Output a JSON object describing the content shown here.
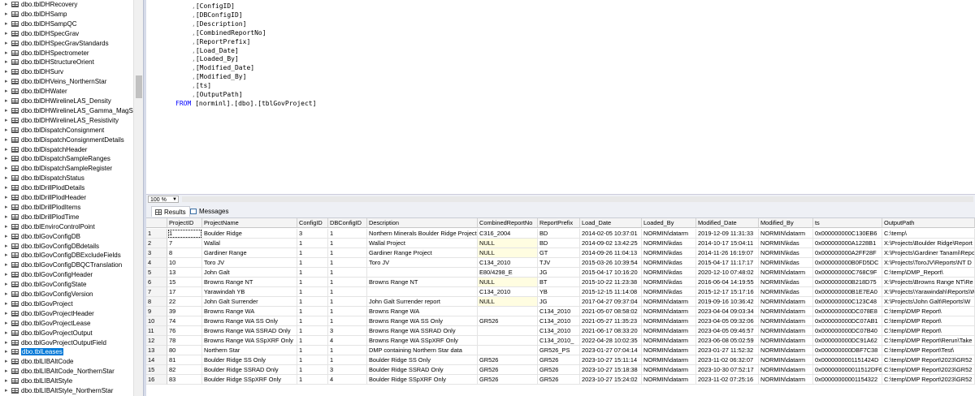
{
  "explorer": {
    "items": [
      {
        "label": "dbo.tblDHRecovery",
        "selected": false
      },
      {
        "label": "dbo.tblDHSamp",
        "selected": false
      },
      {
        "label": "dbo.tblDHSampQC",
        "selected": false
      },
      {
        "label": "dbo.tblDHSpecGrav",
        "selected": false
      },
      {
        "label": "dbo.tblDHSpecGravStandards",
        "selected": false
      },
      {
        "label": "dbo.tblDHSpectrometer",
        "selected": false
      },
      {
        "label": "dbo.tblDHStructureOrient",
        "selected": false
      },
      {
        "label": "dbo.tblDHSurv",
        "selected": false
      },
      {
        "label": "dbo.tblDHVeins_NorthernStar",
        "selected": false
      },
      {
        "label": "dbo.tblDHWater",
        "selected": false
      },
      {
        "label": "dbo.tblDHWirelineLAS_Density",
        "selected": false
      },
      {
        "label": "dbo.tblDHWirelineLAS_Gamma_MagS",
        "selected": false
      },
      {
        "label": "dbo.tblDHWirelineLAS_Resistivity",
        "selected": false
      },
      {
        "label": "dbo.tblDispatchConsignment",
        "selected": false
      },
      {
        "label": "dbo.tblDispatchConsignmentDetails",
        "selected": false
      },
      {
        "label": "dbo.tblDispatchHeader",
        "selected": false
      },
      {
        "label": "dbo.tblDispatchSampleRanges",
        "selected": false
      },
      {
        "label": "dbo.tblDispatchSampleRegister",
        "selected": false
      },
      {
        "label": "dbo.tblDispatchStatus",
        "selected": false
      },
      {
        "label": "dbo.tblDrillPlodDetails",
        "selected": false
      },
      {
        "label": "dbo.tblDrillPlodHeader",
        "selected": false
      },
      {
        "label": "dbo.tblDrillPlodItems",
        "selected": false
      },
      {
        "label": "dbo.tblDrillPlodTime",
        "selected": false
      },
      {
        "label": "dbo.tblEnviroControlPoint",
        "selected": false
      },
      {
        "label": "dbo.tblGovConfigDB",
        "selected": false
      },
      {
        "label": "dbo.tblGovConfigDBdetails",
        "selected": false
      },
      {
        "label": "dbo.tblGovConfigDBExcludeFields",
        "selected": false
      },
      {
        "label": "dbo.tblGovConfigDBQCTranslation",
        "selected": false
      },
      {
        "label": "dbo.tblGovConfigHeader",
        "selected": false
      },
      {
        "label": "dbo.tblGovConfigState",
        "selected": false
      },
      {
        "label": "dbo.tblGovConfigVersion",
        "selected": false
      },
      {
        "label": "dbo.tblGovProject",
        "selected": false
      },
      {
        "label": "dbo.tblGovProjectHeader",
        "selected": false
      },
      {
        "label": "dbo.tblGovProjectLease",
        "selected": false
      },
      {
        "label": "dbo.tblGovProjectOutput",
        "selected": false
      },
      {
        "label": "dbo.tblGovProjectOutputField",
        "selected": false
      },
      {
        "label": "dbo.tblLeases",
        "selected": true
      },
      {
        "label": "dbo.tblLIBAltCode",
        "selected": false
      },
      {
        "label": "dbo.tblLIBAltCode_NorthernStar",
        "selected": false
      },
      {
        "label": "dbo.tblLIBAltStyle",
        "selected": false
      },
      {
        "label": "dbo.tblLIBAltStyle_NorthernStar",
        "selected": false
      }
    ]
  },
  "editor": {
    "lines": [
      {
        "indent": ",",
        "text": "[ConfigID]"
      },
      {
        "indent": ",",
        "text": "[DBConfigID]"
      },
      {
        "indent": ",",
        "text": "[Description]"
      },
      {
        "indent": ",",
        "text": "[CombinedReportNo]"
      },
      {
        "indent": ",",
        "text": "[ReportPrefix]"
      },
      {
        "indent": ",",
        "text": "[Load_Date]"
      },
      {
        "indent": ",",
        "text": "[Loaded_By]"
      },
      {
        "indent": ",",
        "text": "[Modified_Date]"
      },
      {
        "indent": ",",
        "text": "[Modified_By]"
      },
      {
        "indent": ",",
        "text": "[ts]"
      },
      {
        "indent": ",",
        "text": "[OutputPath]"
      }
    ],
    "from_keyword": "FROM",
    "from_text": "[norminl].[dbo].[tblGovProject]"
  },
  "zoom": {
    "value": "100 %"
  },
  "tabs": [
    {
      "label": "Results",
      "icon": "grid-icon",
      "active": true
    },
    {
      "label": "Messages",
      "icon": "messages-icon",
      "active": false
    }
  ],
  "results": {
    "columns": [
      "ProjectID",
      "ProjectName",
      "ConfigID",
      "DBConfigID",
      "Description",
      "CombinedReportNo",
      "ReportPrefix",
      "Load_Date",
      "Loaded_By",
      "Modified_Date",
      "Modified_By",
      "ts",
      "OutputPath"
    ],
    "rows": [
      [
        "1",
        "1",
        "Boulder Ridge",
        "3",
        "1",
        "Northern Minerals Boulder Ridge Project",
        "C316_2004",
        "BD",
        "2014-02-05 10:37:01",
        "NORMIN\\datarm",
        "2019-12-09 11:31:33",
        "NORMIN\\datarm",
        "0x000000000C130EB6",
        "C:\\temp\\"
      ],
      [
        "2",
        "7",
        "Wallal",
        "1",
        "1",
        "Wallal Project",
        "NULL",
        "BD",
        "2014-09-02 13:42:25",
        "NORMIN\\kdas",
        "2014-10-17 15:04:11",
        "NORMIN\\kdas",
        "0x000000000A1228B1",
        "X:\\Projects\\Boulder Ridge\\Report"
      ],
      [
        "3",
        "8",
        "Gardiner Range",
        "1",
        "1",
        "Gardiner Range Project",
        "NULL",
        "GT",
        "2014-09-26 11:04:13",
        "NORMIN\\kdas",
        "2014-11-26 16:19:07",
        "NORMIN\\kdas",
        "0x000000000A2FF28F",
        "X:\\Projects\\Gardiner Tanami\\Report"
      ],
      [
        "4",
        "10",
        "Toro JV",
        "1",
        "1",
        "Toro JV",
        "C134_2010",
        "TJV",
        "2015-03-26 10:39:54",
        "NORMIN\\kdas",
        "2015-04-17 11:17:17",
        "NORMIN\\kdas",
        "0x000000000B0FD5DC",
        "X:\\Projects\\ToroJV\\Reports\\NT D"
      ],
      [
        "5",
        "13",
        "John Galt",
        "1",
        "1",
        "",
        "E80/4298_E",
        "JG",
        "2015-04-17 10:16:20",
        "NORMIN\\kdas",
        "2020-12-10 07:48:02",
        "NORMIN\\datarm",
        "0x000000000C768C9F",
        "C:\\temp\\DMP_Report\\"
      ],
      [
        "6",
        "15",
        "Browns Range NT",
        "1",
        "1",
        "Browns Range NT",
        "NULL",
        "BT",
        "2015-10-22 11:23:38",
        "NORMIN\\kdas",
        "2016-06-04 14:19:55",
        "NORMIN\\kdas",
        "0x000000000B218D75",
        "X:\\Projects\\Browns Range NT\\Re"
      ],
      [
        "7",
        "17",
        "Yarawindah YB",
        "1",
        "1",
        "",
        "C134_2010",
        "YB",
        "2015-12-15 11:14:08",
        "NORMIN\\kdas",
        "2015-12-17 15:17:16",
        "NORMIN\\kdas",
        "0x000000000B1E7EA0",
        "X:\\Projects\\Yarawindah\\Reports\\W"
      ],
      [
        "8",
        "22",
        "John Galt Surrender",
        "1",
        "1",
        "John Galt Surrender report",
        "NULL",
        "JG",
        "2017-04-27 09:37:04",
        "NORMIN\\datarm",
        "2019-09-16 10:36:42",
        "NORMIN\\datarm",
        "0x000000000C123C48",
        "X:\\Projects\\John Galt\\Reports\\W"
      ],
      [
        "9",
        "39",
        "Browns Range WA",
        "1",
        "1",
        "Browns Range WA",
        "",
        "C134_2010",
        "2021-05-07 08:58:02",
        "NORMIN\\datarm",
        "2023-04-04 09:03:34",
        "NORMIN\\datarm",
        "0x000000000DC078E8",
        "C:\\temp\\DMP Report\\"
      ],
      [
        "10",
        "74",
        "Browns Range WA SS Only",
        "1",
        "1",
        "Browns Range WA SS Only",
        "GR526",
        "C134_2010",
        "2021-05-27 11:35:23",
        "NORMIN\\datarm",
        "2023-04-05 09:32:06",
        "NORMIN\\datarm",
        "0x000000000DC07AB1",
        "C:\\temp\\DMP Report\\"
      ],
      [
        "11",
        "76",
        "Browns Range WA SSRAD Only",
        "1",
        "3",
        "Browns Range WA SSRAD Only",
        "",
        "C134_2010",
        "2021-06-17 08:33:20",
        "NORMIN\\datarm",
        "2023-04-05 09:46:57",
        "NORMIN\\datarm",
        "0x000000000DC07B40",
        "C:\\temp\\DMP Report\\"
      ],
      [
        "12",
        "78",
        "Browns Range WA SSpXRF Only",
        "1",
        "4",
        "Browns Range WA SSpXRF Only",
        "",
        "C134_2010_",
        "2022-04-28 10:02:35",
        "NORMIN\\datarm",
        "2023-06-08 05:02:59",
        "NORMIN\\datarm",
        "0x000000000DC91A62",
        "C:\\temp\\DMP Report\\Rerun\\Take"
      ],
      [
        "13",
        "80",
        "Northern Star",
        "1",
        "1",
        "DMP containing Northern Star data",
        "",
        "GR526_PS",
        "2023-01-27 07:04:14",
        "NORMIN\\datarm",
        "2023-01-27 11:52:32",
        "NORMIN\\datarm",
        "0x000000000DBF7C38",
        "C:\\temp\\DMP Report\\Test\\"
      ],
      [
        "14",
        "81",
        "Boulder Ridge SS Only",
        "1",
        "1",
        "Boulder Ridge SS Only",
        "GR526",
        "GR526",
        "2023-10-27 15:11:14",
        "NORMIN\\datarm",
        "2023-11-02 06:32:07",
        "NORMIN\\datarm",
        "0x0000000001151424D",
        "C:\\temp\\DMP Report\\2023\\GR52"
      ],
      [
        "15",
        "82",
        "Boulder Ridge SSRAD Only",
        "1",
        "3",
        "Boulder Ridge SSRAD Only",
        "GR526",
        "GR526",
        "2023-10-27 15:18:38",
        "NORMIN\\datarm",
        "2023-10-30 07:52:17",
        "NORMIN\\datarm",
        "0x000000000011512DF6",
        "C:\\temp\\DMP Report\\2023\\GR52"
      ],
      [
        "16",
        "83",
        "Boulder Ridge SSpXRF Only",
        "1",
        "4",
        "Boulder Ridge SSpXRF Only",
        "GR526",
        "GR526",
        "2023-10-27 15:24:02",
        "NORMIN\\datarm",
        "2023-11-02 07:25:16",
        "NORMIN\\datarm",
        "0x00000000001154322",
        "C:\\temp\\DMP Report\\2023\\GR52"
      ]
    ]
  }
}
